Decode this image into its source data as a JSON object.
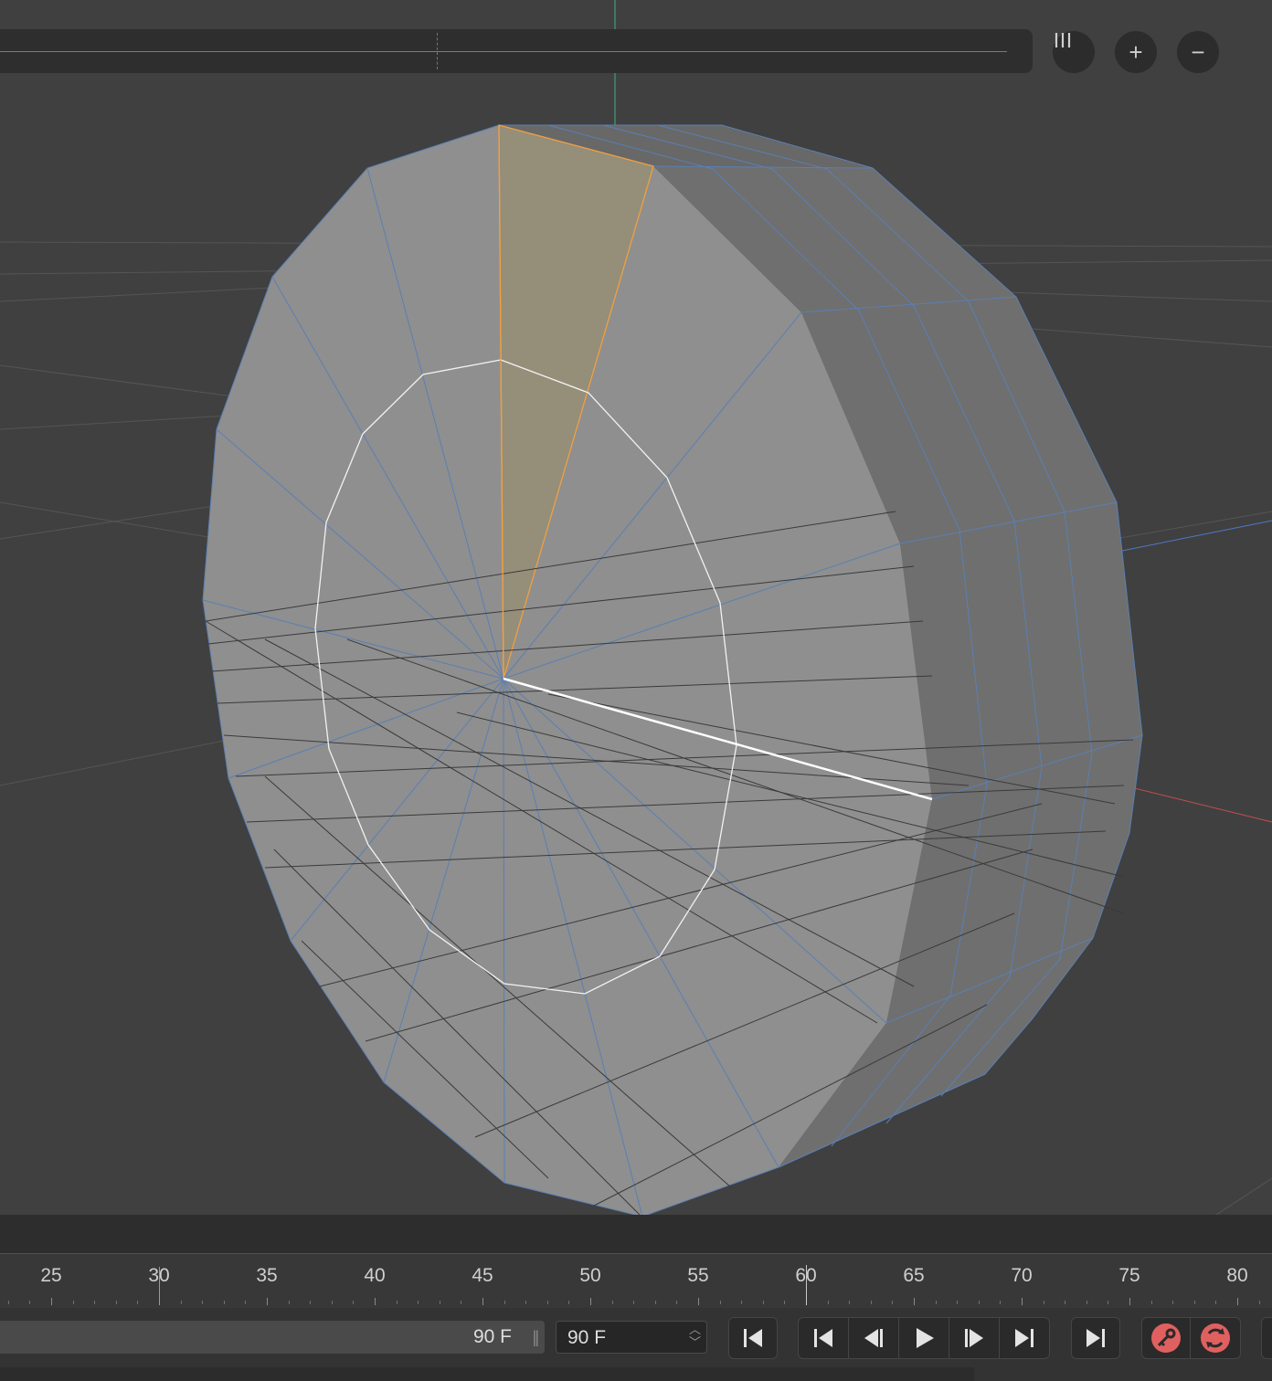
{
  "toolbar": {
    "columns_icon": "columns-icon",
    "zoom_in_label": "+",
    "zoom_out_label": "−"
  },
  "timeline": {
    "ruler_labels": [
      "25",
      "30",
      "35",
      "40",
      "45",
      "50",
      "55",
      "60",
      "65",
      "70",
      "75",
      "80"
    ],
    "current_frame": 60,
    "range_end_value": "90 F",
    "frame_field_value": "90 F",
    "grip_label": "||"
  },
  "transport": {
    "buttons": [
      "go-to-start-icon",
      "go-to-previous-key-icon",
      "step-back-icon",
      "play-icon",
      "step-forward-icon",
      "go-to-next-key-icon",
      "go-to-end-icon",
      "record-key-icon",
      "autokey-icon"
    ]
  },
  "colors": {
    "viewport_bg": "#404040",
    "mesh_face": "#8f8f8f",
    "mesh_side": "#6e6e6e",
    "selected_face": "#958e79",
    "selected_edge": "#f0a040",
    "wire": "#5b7fb3",
    "record_red": "#e06060"
  }
}
